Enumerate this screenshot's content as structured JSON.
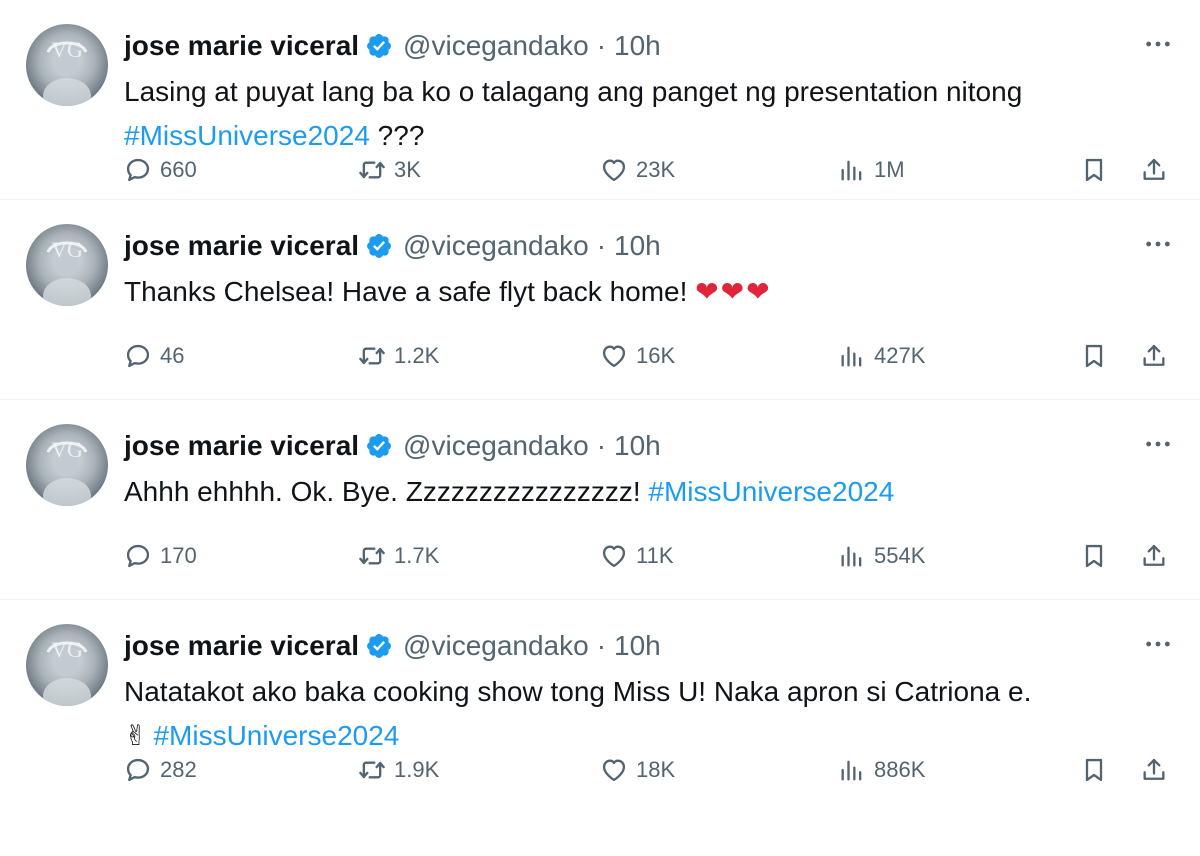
{
  "colors": {
    "link": "#1d9bf0",
    "muted": "#536471",
    "text": "#0f1419",
    "verified": "#1d9bf0"
  },
  "tweets": [
    {
      "author": "jose marie viceral",
      "handle": "@vicegandako",
      "separator": "·",
      "time": "10h",
      "text_main": "Lasing at puyat lang ba ko o talagang ang panget ng presentation nitong ",
      "hashtag": "#MissUniverse2024",
      "text_after": " ???",
      "replies": "660",
      "reposts": "3K",
      "likes": "23K",
      "views": "1M"
    },
    {
      "author": "jose marie viceral",
      "handle": "@vicegandako",
      "separator": "·",
      "time": "10h",
      "text_main": "Thanks Chelsea! Have a safe flyt back home! ",
      "emoji": "❤❤❤",
      "replies": "46",
      "reposts": "1.2K",
      "likes": "16K",
      "views": "427K"
    },
    {
      "author": "jose marie viceral",
      "handle": "@vicegandako",
      "separator": "·",
      "time": "10h",
      "text_main": "Ahhh ehhhh. Ok. Bye. Zzzzzzzzzzzzzzzz!  ",
      "hashtag": "#MissUniverse2024",
      "replies": "170",
      "reposts": "1.7K",
      "likes": "11K",
      "views": "554K"
    },
    {
      "author": "jose marie viceral",
      "handle": "@vicegandako",
      "separator": "·",
      "time": "10h",
      "text_main": "Natatakot ako baka cooking show tong Miss U! Naka apron si Catriona e.",
      "emoji_prefix": "✌",
      "hashtag": "#MissUniverse2024",
      "replies": "282",
      "reposts": "1.9K",
      "likes": "18K",
      "views": "886K"
    }
  ],
  "icons": [
    "avatar-image",
    "verified-badge-icon",
    "more-options-icon",
    "reply-icon",
    "repost-icon",
    "like-icon",
    "views-icon",
    "bookmark-icon",
    "share-icon"
  ]
}
